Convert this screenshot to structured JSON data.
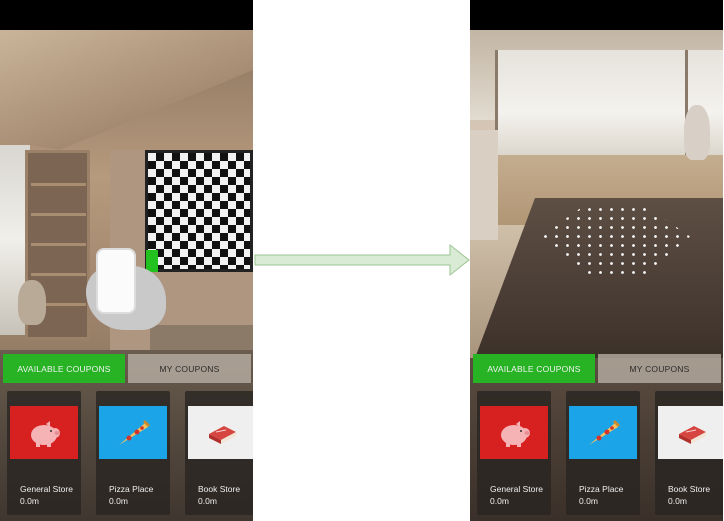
{
  "colors": {
    "accent_green": "#27b324",
    "tab_inactive": "#beb4aa",
    "arrow_fill": "#d9ebd5",
    "arrow_stroke": "#9cc48f"
  },
  "screens": [
    {
      "id": "before",
      "tabs": {
        "available": "AVAILABLE COUPONS",
        "mine": "MY COUPONS"
      },
      "coupons": [
        {
          "name": "General Store",
          "distance": "0.0m",
          "icon": "piggy-bank-icon"
        },
        {
          "name": "Pizza Place",
          "distance": "0.0m",
          "icon": "pizza-slice-icon"
        },
        {
          "name": "Book Store",
          "distance": "0.0m",
          "icon": "book-icon"
        }
      ]
    },
    {
      "id": "after",
      "tabs": {
        "available": "AVAILABLE COUPONS",
        "mine": "MY COUPONS"
      },
      "coupons": [
        {
          "name": "General Store",
          "distance": "0.0m",
          "icon": "piggy-bank-icon"
        },
        {
          "name": "Pizza Place",
          "distance": "0.0m",
          "icon": "pizza-slice-icon"
        },
        {
          "name": "Book Store",
          "distance": "0.0m",
          "icon": "book-icon"
        }
      ]
    }
  ],
  "transition_icon": "right-arrow-icon"
}
